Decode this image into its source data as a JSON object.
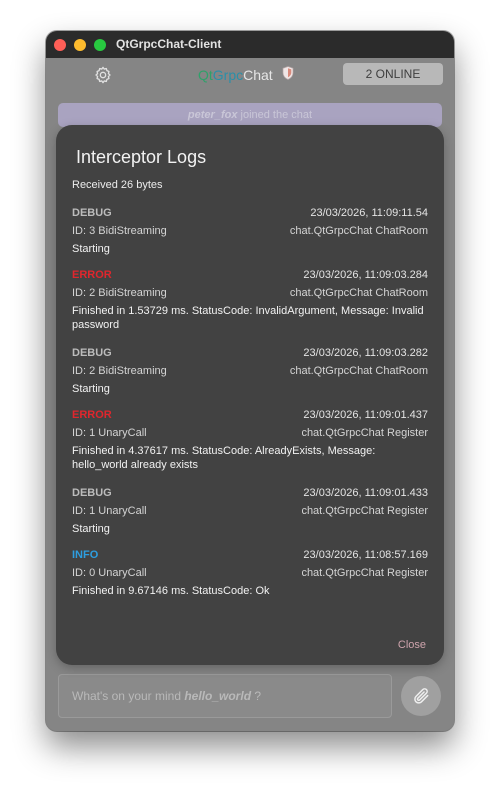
{
  "window": {
    "title": "QtGrpcChat-Client"
  },
  "header": {
    "brand_part1": "Qt",
    "brand_part2": "Grpc",
    "brand_part3": "Chat",
    "online_label": "2 ONLINE"
  },
  "notice": {
    "user": "peter_fox",
    "text": " joined the chat"
  },
  "modal": {
    "title": "Interceptor Logs",
    "partial_line": "Received 26 bytes",
    "close_label": "Close",
    "entries": [
      {
        "level": "DEBUG",
        "timestamp": "23/03/2026, 11:09:11.54",
        "id": "ID: 3  BidiStreaming",
        "method": "chat.QtGrpcChat  ChatRoom",
        "message": "Starting"
      },
      {
        "level": "ERROR",
        "timestamp": "23/03/2026, 11:09:03.284",
        "id": "ID: 2  BidiStreaming",
        "method": "chat.QtGrpcChat  ChatRoom",
        "message": "Finished in 1.53729 ms. StatusCode: InvalidArgument, Message: Invalid password"
      },
      {
        "level": "DEBUG",
        "timestamp": "23/03/2026, 11:09:03.282",
        "id": "ID: 2  BidiStreaming",
        "method": "chat.QtGrpcChat  ChatRoom",
        "message": "Starting"
      },
      {
        "level": "ERROR",
        "timestamp": "23/03/2026, 11:09:01.437",
        "id": "ID: 1  UnaryCall",
        "method": "chat.QtGrpcChat  Register",
        "message": "Finished in 4.37617 ms. StatusCode: AlreadyExists, Message: hello_world already exists"
      },
      {
        "level": "DEBUG",
        "timestamp": "23/03/2026, 11:09:01.433",
        "id": "ID: 1  UnaryCall",
        "method": "chat.QtGrpcChat  Register",
        "message": "Starting"
      },
      {
        "level": "INFO",
        "timestamp": "23/03/2026, 11:08:57.169",
        "id": "ID: 0  UnaryCall",
        "method": "chat.QtGrpcChat  Register",
        "message": "Finished in 9.67146 ms. StatusCode: Ok"
      }
    ]
  },
  "input": {
    "placeholder_prefix": "What's on your mind ",
    "user": "hello_world",
    "placeholder_suffix": " ?"
  },
  "icons": {
    "settings": "gear-icon",
    "brand_badge": "shield-icon",
    "attach": "paperclip-icon"
  },
  "colors": {
    "level_DEBUG": "#bcbcbc",
    "level_ERROR": "#e0262d",
    "level_INFO": "#2d9ee0",
    "accent_close": "#cfa4ad",
    "brand_qt": "#2fa16a",
    "brand_grpc": "#2b8fa8"
  }
}
